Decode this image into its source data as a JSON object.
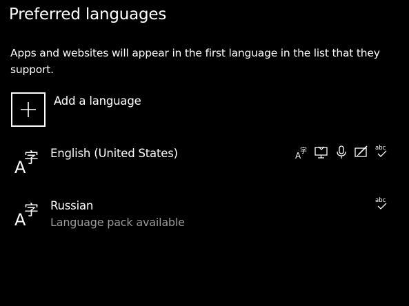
{
  "page": {
    "title": "Preferred languages",
    "description": "Apps and websites will appear in the first language in the list that they support."
  },
  "add_language": {
    "label": "Add a language",
    "icon": "plus-icon"
  },
  "languages": [
    {
      "name": "English (United States)",
      "status": "",
      "feature_icons": [
        "display-language-icon",
        "text-to-speech-icon",
        "speech-recognition-icon",
        "handwriting-icon",
        "spell-check-icon"
      ]
    },
    {
      "name": "Russian",
      "status": "Language pack available",
      "feature_icons": [
        "spell-check-icon"
      ]
    }
  ],
  "colors": {
    "background": "#000000",
    "text": "#ffffff",
    "secondary_text": "#9a9a9a"
  }
}
